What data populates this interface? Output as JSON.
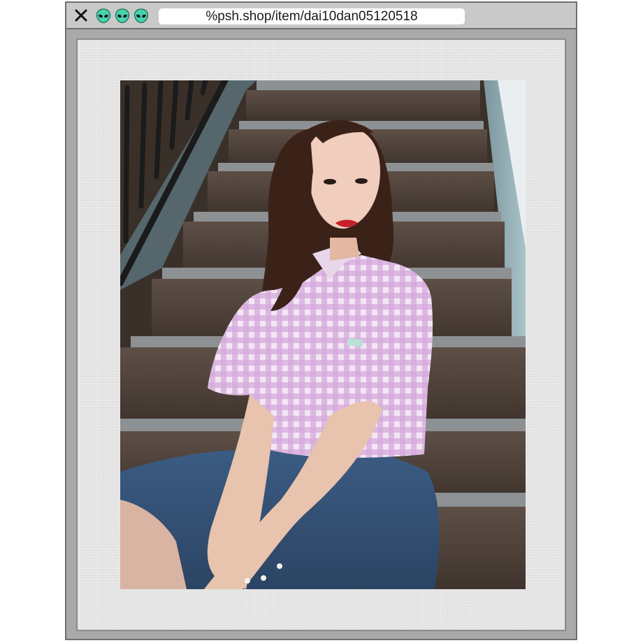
{
  "browser": {
    "url": "%psh.shop/item/dai10dan05120518",
    "close_icon": "close-icon",
    "tab_icons": [
      "alien-icon",
      "alien-icon",
      "alien-icon"
    ]
  },
  "photo": {
    "subject": "woman-on-stairs"
  },
  "colors": {
    "frame": "#a9a9a9",
    "titlebar": "#c9c9c9",
    "alien": "#46d4a8",
    "mat": "#e6e6e6"
  }
}
